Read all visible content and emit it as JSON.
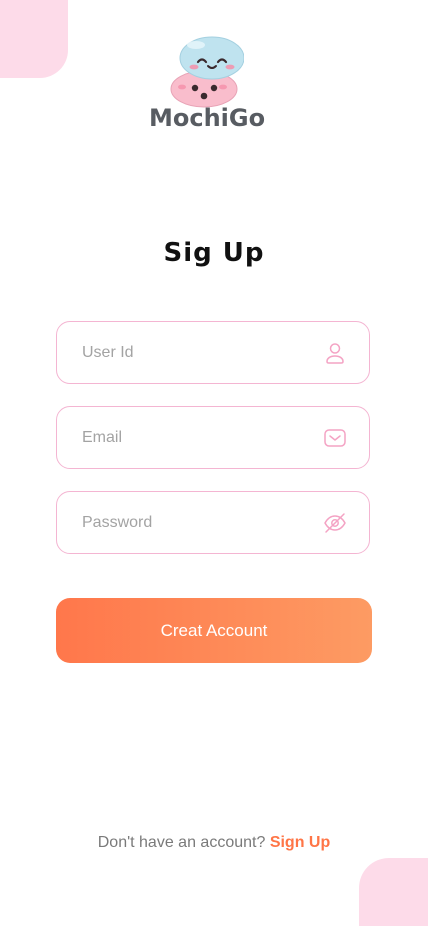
{
  "brand": {
    "name": "MochiGo",
    "logo_icon": "mochi-mascot-icon",
    "text_color": "#585c62"
  },
  "page": {
    "title": "Sig Up"
  },
  "form": {
    "user_id": {
      "placeholder": "User Id",
      "value": "",
      "icon": "user-icon"
    },
    "email": {
      "placeholder": "Email",
      "value": "",
      "icon": "mail-icon"
    },
    "password": {
      "placeholder": "Password",
      "value": "",
      "icon": "eye-off-icon"
    },
    "submit_label": "Creat Account"
  },
  "footer": {
    "prompt": "Don't have an account?",
    "link_label": "Sign Up"
  },
  "colors": {
    "accent": "#ff7546",
    "button_gradient_start": "#ff774b",
    "button_gradient_end": "#fd9b63",
    "field_border": "#f4b5d2",
    "decor_pink": "#fddbe9"
  }
}
